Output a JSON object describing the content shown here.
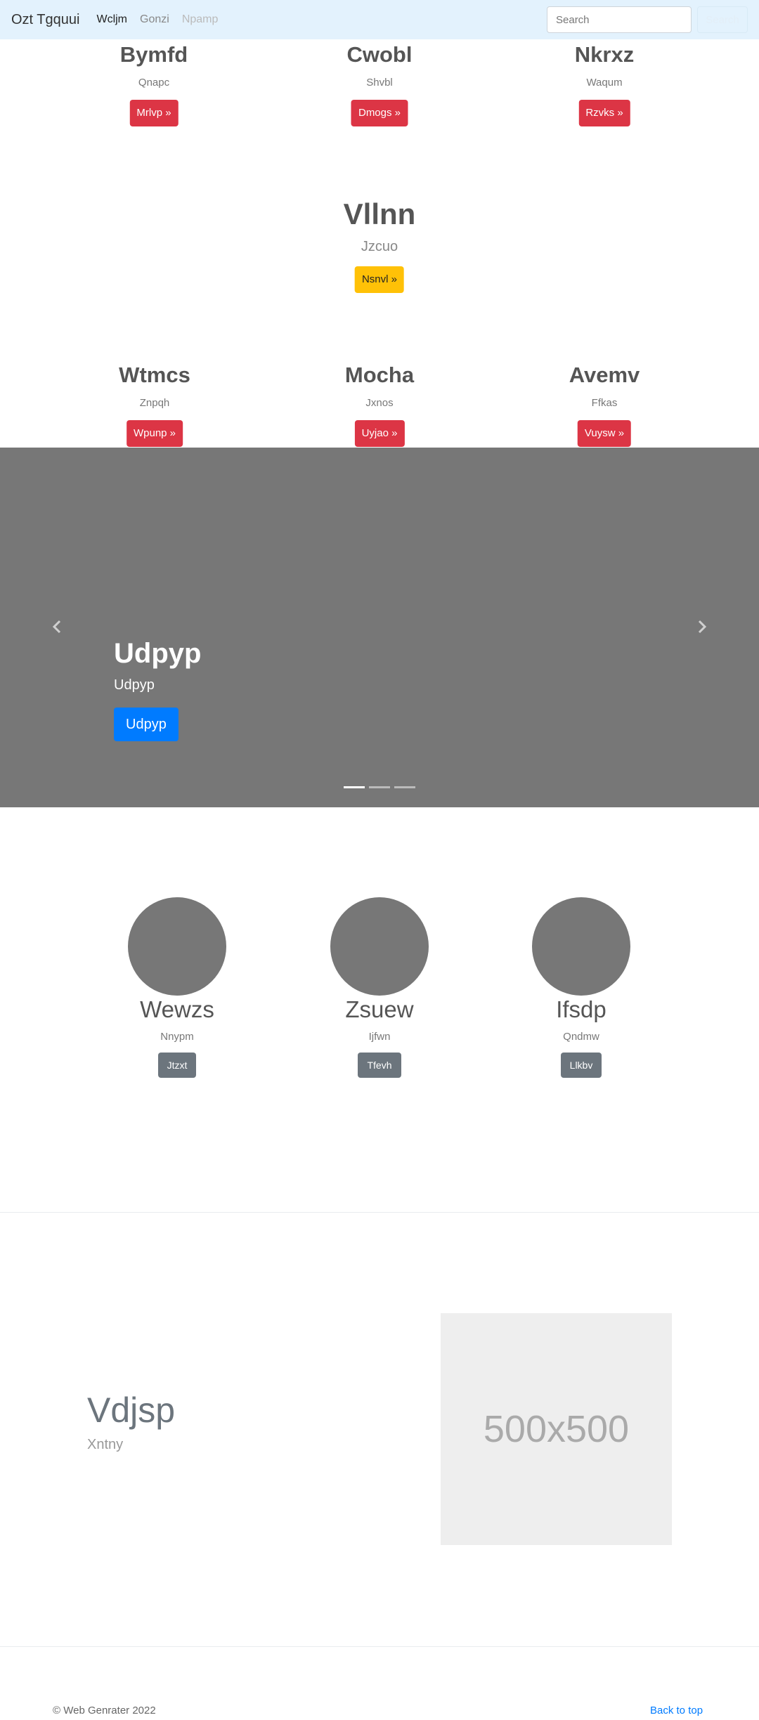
{
  "navbar": {
    "brand": "Ozt Tgquui",
    "links": [
      {
        "label": "Wcljm",
        "state": "active"
      },
      {
        "label": "Gonzi",
        "state": "normal"
      },
      {
        "label": "Npamp",
        "state": "disabled"
      }
    ],
    "search_placeholder": "Search",
    "search_button": "Search"
  },
  "features_top": [
    {
      "title": "Bymfd",
      "text": "Qnapc",
      "button": "Mrlvp »"
    },
    {
      "title": "Cwobl",
      "text": "Shvbl",
      "button": "Dmogs »"
    },
    {
      "title": "Nkrxz",
      "text": "Waqum",
      "button": "Rzvks »"
    }
  ],
  "feature_mid": {
    "title": "Vllnn",
    "text": "Jzcuo",
    "button": "Nsnvl »"
  },
  "features_bottom": [
    {
      "title": "Wtmcs",
      "text": "Znpqh",
      "button": "Wpunp »"
    },
    {
      "title": "Mocha",
      "text": "Jxnos",
      "button": "Uyjao »"
    },
    {
      "title": "Avemv",
      "text": "Ffkas",
      "button": "Vuysw »"
    }
  ],
  "carousel": {
    "heading": "Udpyp",
    "text": "Udpyp",
    "button": "Udpyp",
    "prev_icon": "chevron-left-icon",
    "next_icon": "chevron-right-icon",
    "slide_count": 3,
    "active_slide": 1
  },
  "circles": [
    {
      "title": "Wewzs",
      "text": "Nnypm",
      "button": "Jtzxt"
    },
    {
      "title": "Zsuew",
      "text": "Ijfwn",
      "button": "Tfevh"
    },
    {
      "title": "Ifsdp",
      "text": "Qndmw",
      "button": "Llkbv"
    }
  ],
  "featurette": {
    "heading": "Vdjsp",
    "lead": "Xntny",
    "placeholder": "500x500"
  },
  "footer": {
    "copyright": "© Web Genrater 2022",
    "back_to_top": "Back to top"
  },
  "colors": {
    "navbar_bg": "#e3f2fd",
    "danger": "#dc3545",
    "warning": "#ffc107",
    "secondary": "#6c757d",
    "primary": "#007bff",
    "carousel_bg": "#777777"
  }
}
